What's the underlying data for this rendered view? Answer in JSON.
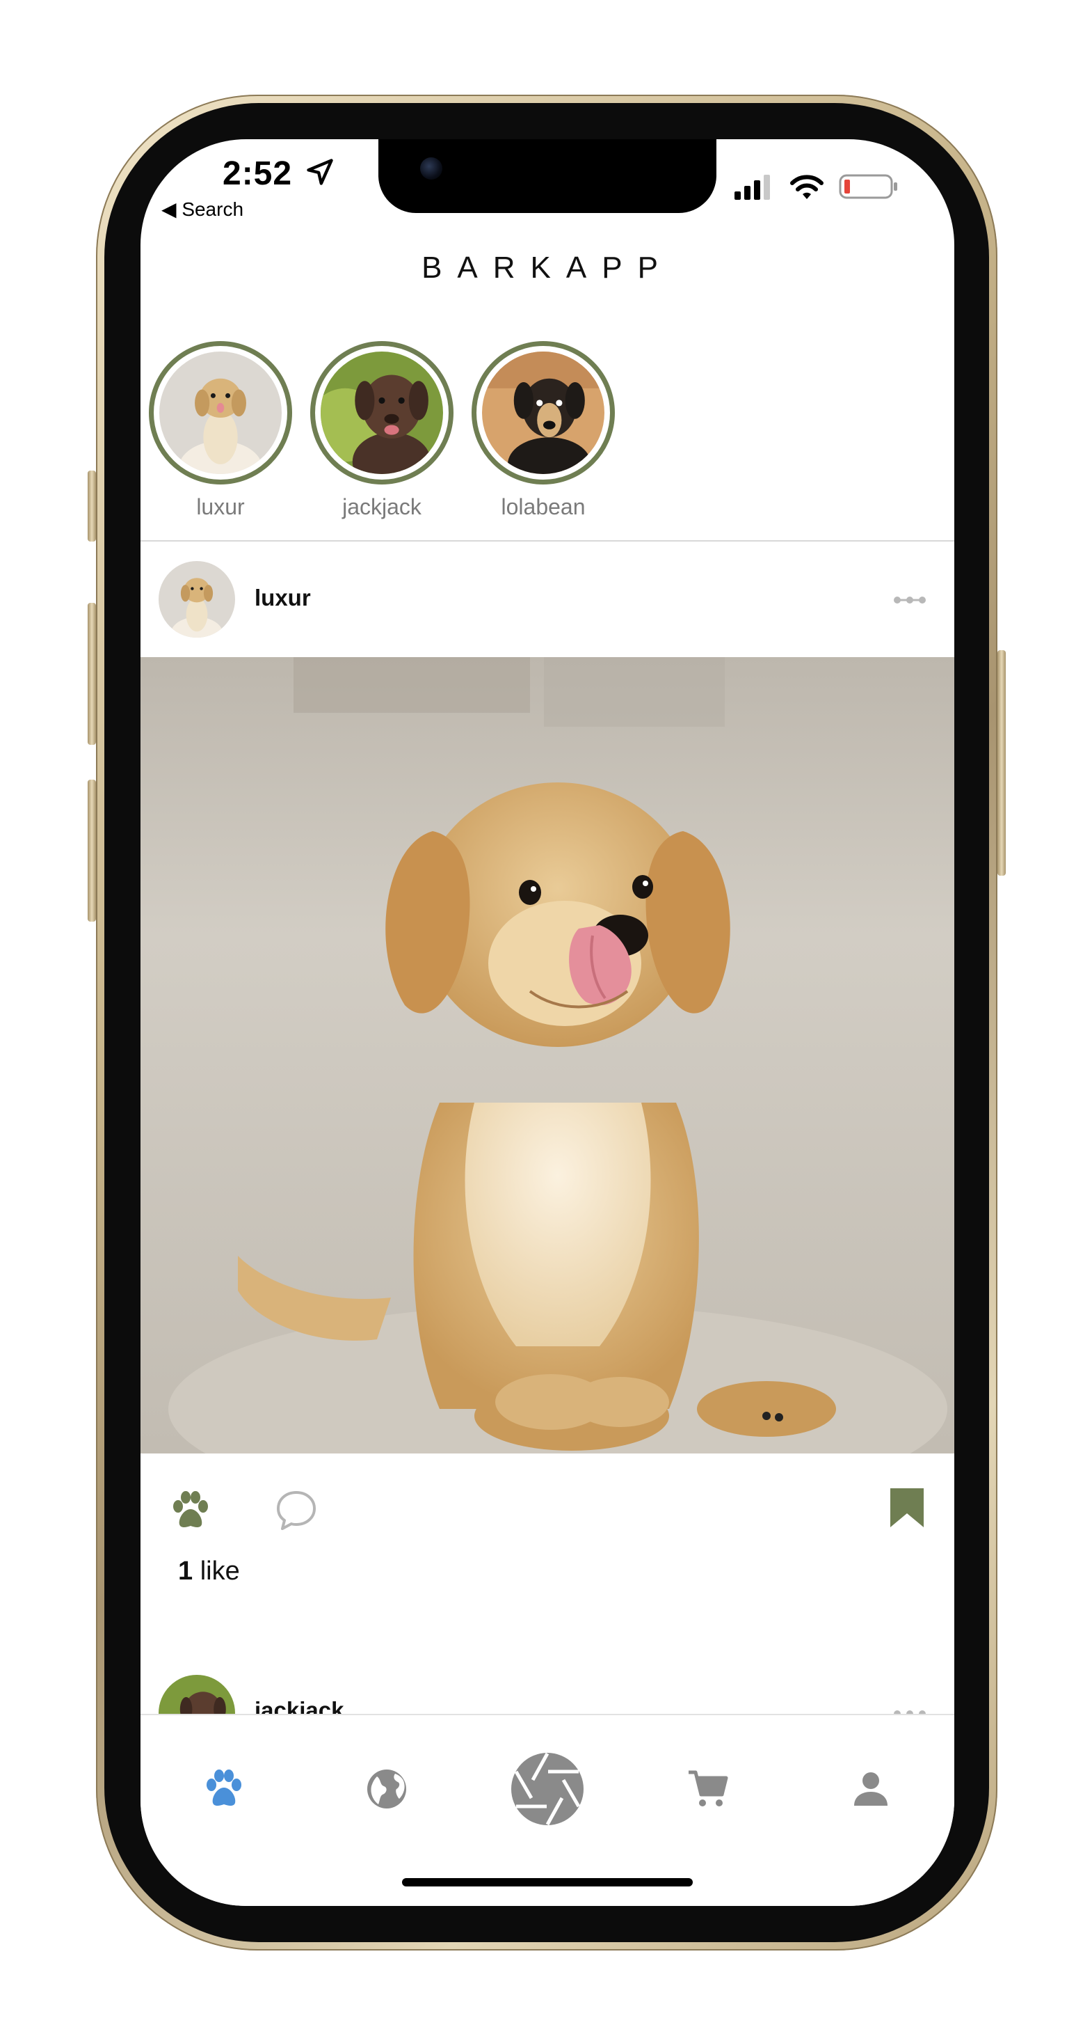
{
  "status_bar": {
    "time": "2:52",
    "back_label": "◀ Search",
    "battery_color": "#e5443a"
  },
  "app": {
    "title": "BARKAPP",
    "accent_color": "#6f7e52",
    "active_tab_color": "#4a90d9"
  },
  "stories": [
    {
      "name": "luxur",
      "avatar": "golden-retriever-puppy"
    },
    {
      "name": "jackjack",
      "avatar": "chocolate-labrador-puppy"
    },
    {
      "name": "lolabean",
      "avatar": "beagle-mix-puppy"
    }
  ],
  "post": {
    "username": "luxur",
    "image": "golden-retriever-puppy-licking-nose",
    "likes_count": "1",
    "likes_label": "like",
    "icons": {
      "like": "paw-icon",
      "comment": "comment-bubble-icon",
      "save": "bookmark-icon",
      "more": "more-dots-icon"
    }
  },
  "next_post": {
    "username": "jackjack"
  },
  "tabbar": {
    "tabs": [
      {
        "name": "home",
        "icon": "paw-icon",
        "active": true
      },
      {
        "name": "explore",
        "icon": "globe-icon",
        "active": false
      },
      {
        "name": "camera",
        "icon": "camera-shutter-icon",
        "active": false
      },
      {
        "name": "shop",
        "icon": "cart-icon",
        "active": false
      },
      {
        "name": "profile",
        "icon": "person-icon",
        "active": false
      }
    ]
  }
}
